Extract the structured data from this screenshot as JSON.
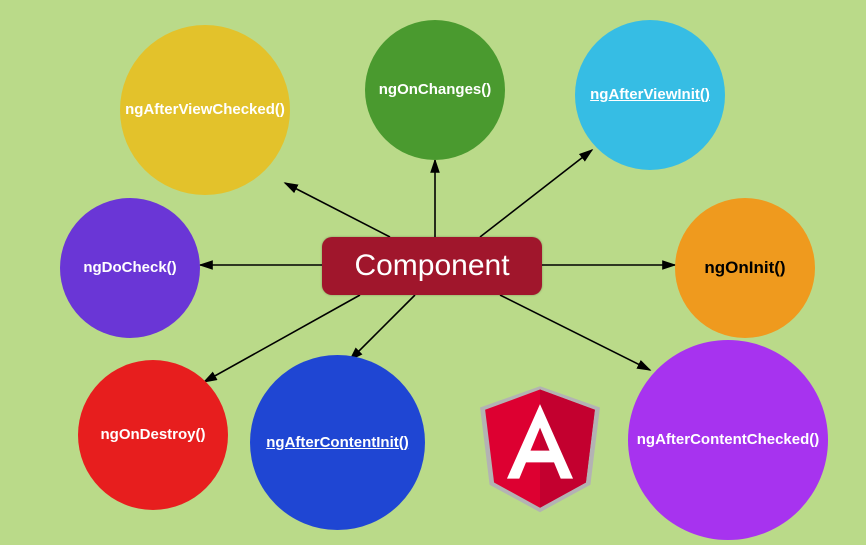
{
  "center": {
    "label": "Component"
  },
  "nodes": {
    "ngOnChanges": {
      "label": "ngOnChanges()",
      "underline": false,
      "link": false
    },
    "ngAfterViewInit": {
      "label": "ngAfterViewInit()",
      "underline": true,
      "link": true
    },
    "ngAfterViewChecked": {
      "label": "ngAfterViewChecked()",
      "underline": false,
      "link": false
    },
    "ngOnInit": {
      "label": "ngOnInit()",
      "underline": false,
      "link": false
    },
    "ngDoCheck": {
      "label": "ngDoCheck()",
      "underline": false,
      "link": false
    },
    "ngAfterContentChecked": {
      "label": "ngAfterContentChecked()",
      "underline": false,
      "link": false
    },
    "ngAfterContentInit": {
      "label": "ngAfterContentInit()",
      "underline": true,
      "link": true
    },
    "ngOnDestroy": {
      "label": "ngOnDestroy()",
      "underline": false,
      "link": false
    }
  },
  "colors": {
    "bg": "#bada89",
    "center": "#a0162c",
    "ngOnChanges": "#4a9a2f",
    "ngAfterViewInit": "#36bde4",
    "ngAfterViewChecked": "#e3c22b",
    "ngOnInit": "#ef9a1e",
    "ngDoCheck": "#6a36d6",
    "ngAfterContentChecked": "#a733ef",
    "ngAfterContentInit": "#1f46d3",
    "ngOnDestroy": "#e71e1e"
  },
  "logo": {
    "name": "angular-logo"
  }
}
